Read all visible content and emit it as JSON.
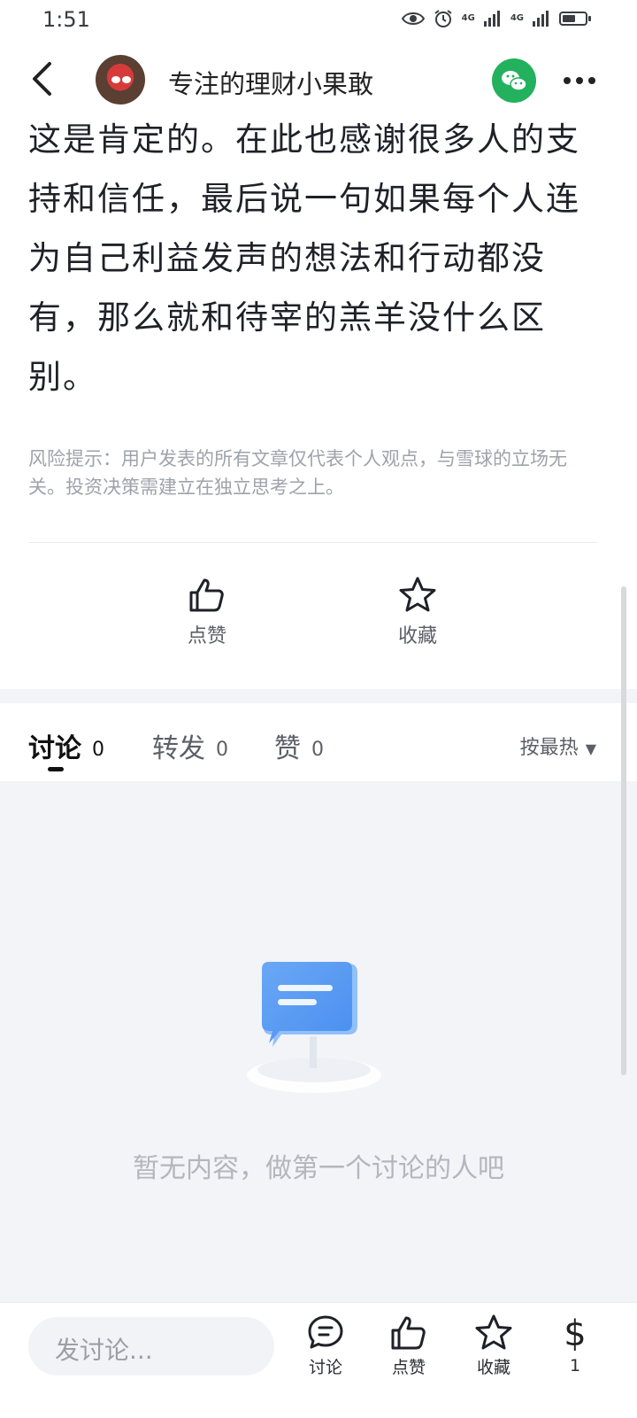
{
  "status_bar": {
    "time": "1:51",
    "signal1": "4G",
    "signal2": "4G"
  },
  "header": {
    "author": "专注的理财小果敢"
  },
  "article": {
    "paragraphs": [
      "这是肯定的。在此也感谢很多人的支",
      "持和信任，最后说一句如果每个人连",
      "为自己利益发声的想法和行动都没",
      "有，那么就和待宰的羔羊没什么区",
      "别。"
    ]
  },
  "risk_note": "风险提示：用户发表的所有文章仅代表个人观点，与雪球的立场无关。投资决策需建立在独立思考之上。",
  "actions": {
    "like": "点赞",
    "favorite": "收藏"
  },
  "tabs": [
    {
      "label": "讨论",
      "count": "0"
    },
    {
      "label": "转发",
      "count": "0"
    },
    {
      "label": "赞",
      "count": "0"
    }
  ],
  "sort_label": "按最热",
  "empty_text": "暂无内容，做第一个讨论的人吧",
  "bottom_bar": {
    "input_placeholder": "发讨论...",
    "discuss": "讨论",
    "like": "点赞",
    "favorite": "收藏",
    "reward_count": "1"
  }
}
